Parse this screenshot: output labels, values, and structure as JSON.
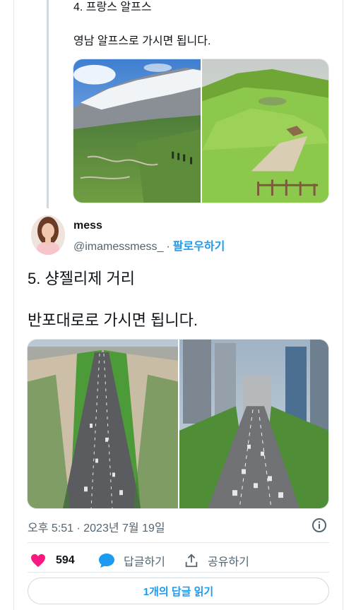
{
  "previous_tweet": {
    "title": "4. 프랑스 알프스",
    "body": "영남 알프스로 가시면 됩니다."
  },
  "author": {
    "display_name": "mess",
    "handle": "@imamessmess_",
    "separator": "·",
    "follow_label": "팔로우하기"
  },
  "tweet": {
    "line1": "5. 샹젤리제 거리",
    "line2": "반포대로로 가시면 됩니다."
  },
  "meta": {
    "timestamp": "오후 5:51 · 2023년 7월 19일"
  },
  "actions": {
    "like_count": "594",
    "reply_label": "답글하기",
    "share_label": "공유하기"
  },
  "read_replies_label": "1개의 답글 읽기",
  "colors": {
    "accent": "#1d9bf0",
    "like": "#f91880",
    "muted_text": "#536471",
    "border": "#e3e8ec"
  },
  "icons": {
    "like": "heart-icon",
    "reply": "speech-bubble-icon",
    "share": "share-upload-icon",
    "info": "info-circle-icon"
  }
}
